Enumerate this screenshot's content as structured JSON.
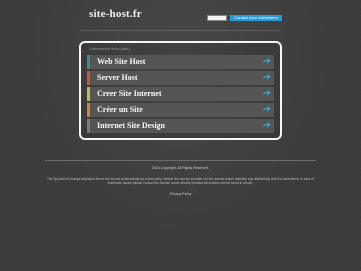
{
  "header": {
    "logo": "site-host.fr",
    "contact_label": "Contact your advertisers"
  },
  "panel": {
    "caption": "Commercial links (ads)",
    "links": [
      {
        "label": "Web Site Host",
        "accent": "#3d8b8b"
      },
      {
        "label": "Server Host",
        "accent": "#c95b2a"
      },
      {
        "label": "Creer Site Internet",
        "accent": "#b9c23a"
      },
      {
        "label": "Créer un Site",
        "accent": "#d9822b"
      },
      {
        "label": "Internet Site Design",
        "accent": "#7a7a7a"
      }
    ],
    "arrow_icon": "arrow-right-icon",
    "accent_color": "#3aa6e0"
  },
  "footer": {
    "copyright": "2016 Copyright. All Rights Reserved.",
    "disclaimer": "The Sponsored Listings displayed above are served automatically by a third party. Neither the service provider nor the domain owner maintain any relationship with the advertisers. In case of trademark issues please contact the domain owner directly (contact information can be found in whois).",
    "privacy": "Privacy Policy"
  },
  "colors": {
    "background": "#3c3c3c",
    "panel_border": "#f5f5f5",
    "contact_button": "#2a9bd7"
  }
}
